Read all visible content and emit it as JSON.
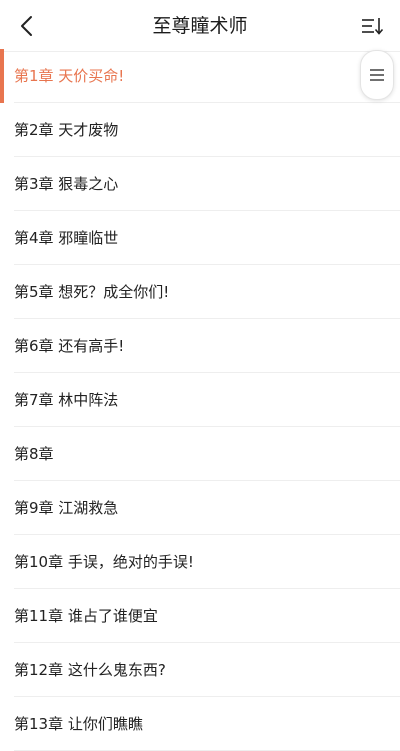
{
  "header": {
    "title": "至尊瞳术师",
    "back_icon": "chevron-left-icon",
    "sort_icon": "sort-descending-icon"
  },
  "active_color": "#e8754f",
  "chapters": [
    {
      "label": "第1章 天价买命!",
      "active": true
    },
    {
      "label": "第2章 天才废物",
      "active": false
    },
    {
      "label": "第3章 狠毒之心",
      "active": false
    },
    {
      "label": "第4章 邪瞳临世",
      "active": false
    },
    {
      "label": "第5章 想死？成全你们!",
      "active": false
    },
    {
      "label": "第6章 还有高手!",
      "active": false
    },
    {
      "label": "第7章 林中阵法",
      "active": false
    },
    {
      "label": "第8章",
      "active": false
    },
    {
      "label": "第9章 江湖救急",
      "active": false
    },
    {
      "label": "第10章 手误，绝对的手误!",
      "active": false
    },
    {
      "label": "第11章 谁占了谁便宜",
      "active": false
    },
    {
      "label": "第12章 这什么鬼东西?",
      "active": false
    },
    {
      "label": "第13章 让你们瞧瞧",
      "active": false
    }
  ],
  "floating_menu_icon": "menu-lines-icon"
}
